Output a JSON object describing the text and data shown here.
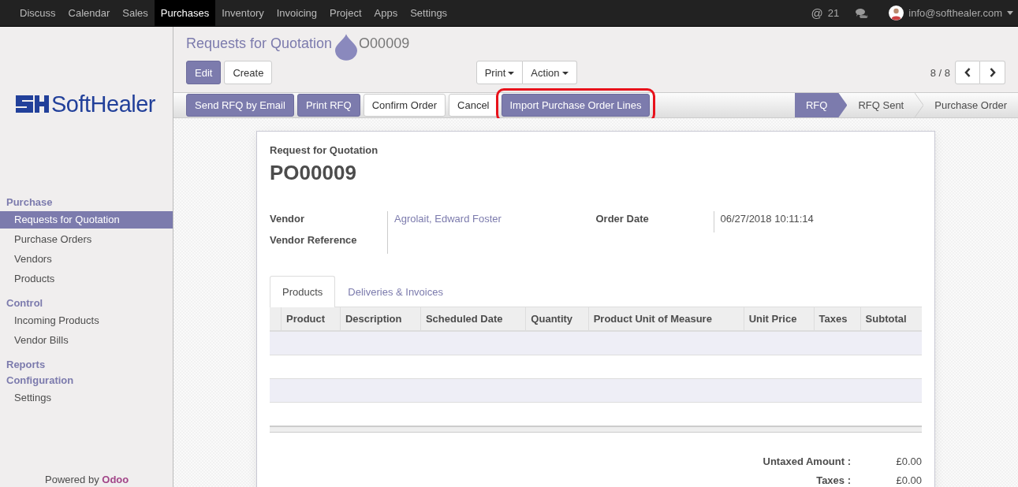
{
  "top_menu": [
    {
      "label": "Discuss",
      "selected": false
    },
    {
      "label": "Calendar",
      "selected": false
    },
    {
      "label": "Sales",
      "selected": false
    },
    {
      "label": "Purchases",
      "selected": true
    },
    {
      "label": "Inventory",
      "selected": false
    },
    {
      "label": "Invoicing",
      "selected": false
    },
    {
      "label": "Project",
      "selected": false
    },
    {
      "label": "Apps",
      "selected": false
    },
    {
      "label": "Settings",
      "selected": false
    }
  ],
  "systray": {
    "mention_symbol": "@",
    "mention_count": "21",
    "user_email": "info@softhealer.com"
  },
  "logo": {
    "text": "SoftHealer"
  },
  "sidebar": {
    "sections": [
      {
        "title": "Purchase",
        "items": [
          {
            "label": "Requests for Quotation",
            "selected": true
          },
          {
            "label": "Purchase Orders",
            "selected": false
          },
          {
            "label": "Vendors",
            "selected": false
          },
          {
            "label": "Products",
            "selected": false
          }
        ]
      },
      {
        "title": "Control",
        "items": [
          {
            "label": "Incoming Products",
            "selected": false
          },
          {
            "label": "Vendor Bills",
            "selected": false
          }
        ]
      },
      {
        "title": "Reports"
      },
      {
        "title": "Configuration",
        "items": [
          {
            "label": "Settings",
            "selected": false
          }
        ]
      }
    ],
    "footer": "Powered by **Odoo**"
  },
  "breadcrumb": {
    "parent": "Requests for Quotation",
    "current": "O00009"
  },
  "actions": [
    {
      "label": "Edit",
      "kind": "primary"
    },
    {
      "label": "Create",
      "kind": "default"
    }
  ],
  "dropdowns": [
    {
      "label": "Print"
    },
    {
      "label": "Action"
    }
  ],
  "pager": {
    "value": "8 / 8"
  },
  "header_buttons": [
    {
      "label": "Send RFQ by Email",
      "kind": "primary",
      "highlighted": false
    },
    {
      "label": "Print RFQ",
      "kind": "primary",
      "highlighted": false
    },
    {
      "label": "Confirm Order",
      "kind": "default",
      "highlighted": false
    },
    {
      "label": "Cancel",
      "kind": "default",
      "highlighted": false
    },
    {
      "label": "Import Purchase Order Lines",
      "kind": "primary",
      "highlighted": true
    }
  ],
  "statuses": [
    {
      "label": "RFQ",
      "selected": true
    },
    {
      "label": "RFQ Sent",
      "selected": false
    },
    {
      "label": "Purchase Order",
      "selected": false
    }
  ],
  "sheet": {
    "doc_type": "Request for Quotation",
    "name": "PO00009",
    "left_fields": [
      {
        "label": "Vendor",
        "value": "Agrolait, Edward Foster",
        "kind": "link"
      },
      {
        "label": "Vendor Reference",
        "kind": "empty"
      }
    ],
    "right_fields": [
      {
        "label": "Order Date",
        "value": "06/27/2018 10:11:14",
        "kind": "text"
      }
    ],
    "tabs": [
      {
        "label": "Products",
        "selected": true
      },
      {
        "label": "Deliveries & Invoices",
        "selected": false
      }
    ],
    "table": {
      "columns": [
        "Product",
        "Description",
        "Scheduled Date",
        "Quantity",
        "Product Unit of Measure",
        "Unit Price",
        "Taxes",
        "Subtotal"
      ]
    },
    "totals": [
      {
        "label": "Untaxed Amount :",
        "value": "£0.00"
      },
      {
        "label": "Taxes :",
        "value": "£0.00"
      }
    ]
  }
}
